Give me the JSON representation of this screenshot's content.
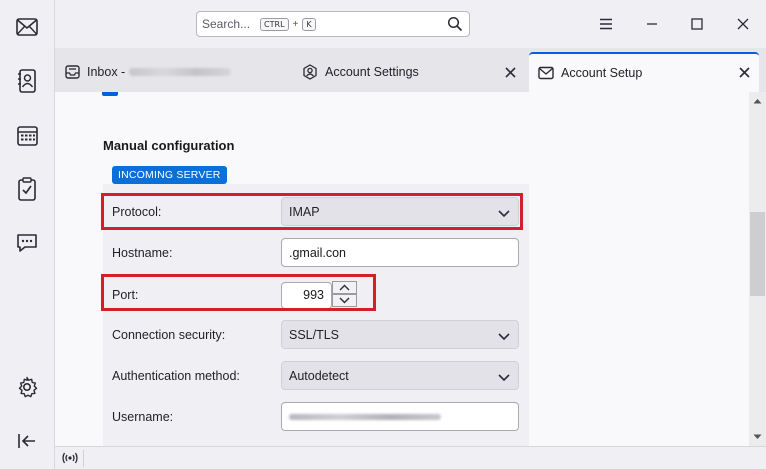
{
  "spaces": {
    "items": [
      {
        "name": "mail",
        "icon": "mail-icon"
      },
      {
        "name": "address-book",
        "icon": "address-book-icon"
      },
      {
        "name": "calendar",
        "icon": "calendar-icon"
      },
      {
        "name": "tasks",
        "icon": "tasks-icon"
      },
      {
        "name": "chat",
        "icon": "chat-icon"
      }
    ],
    "settings_icon": "gear-icon",
    "collapse_icon": "collapse-spaces-icon"
  },
  "search": {
    "placeholder": "Search...",
    "shortcut_ctrl": "CTRL",
    "shortcut_plus": "+",
    "shortcut_key": "K"
  },
  "tabs": [
    {
      "label": "Inbox -",
      "icon": "inbox-icon",
      "active": false,
      "account_obscured": true
    },
    {
      "label": "Account Settings",
      "icon": "account-settings-icon",
      "active": false
    },
    {
      "label": "Account Setup",
      "icon": "mail-setup-icon",
      "active": true
    }
  ],
  "manual_config": {
    "title": "Manual configuration",
    "section_badge": "INCOMING SERVER",
    "fields": {
      "protocol": {
        "label": "Protocol:",
        "value": "IMAP"
      },
      "hostname": {
        "label": "Hostname:",
        "value": ".gmail.con"
      },
      "port": {
        "label": "Port:",
        "value": "993"
      },
      "connection_security": {
        "label": "Connection security:",
        "value": "SSL/TLS"
      },
      "auth_method": {
        "label": "Authentication method:",
        "value": "Autodetect"
      },
      "username": {
        "label": "Username:",
        "value_obscured": true
      }
    }
  },
  "colors": {
    "accent": "#0060df",
    "badge": "#0a6fd8",
    "highlight": "#d21f2b"
  }
}
